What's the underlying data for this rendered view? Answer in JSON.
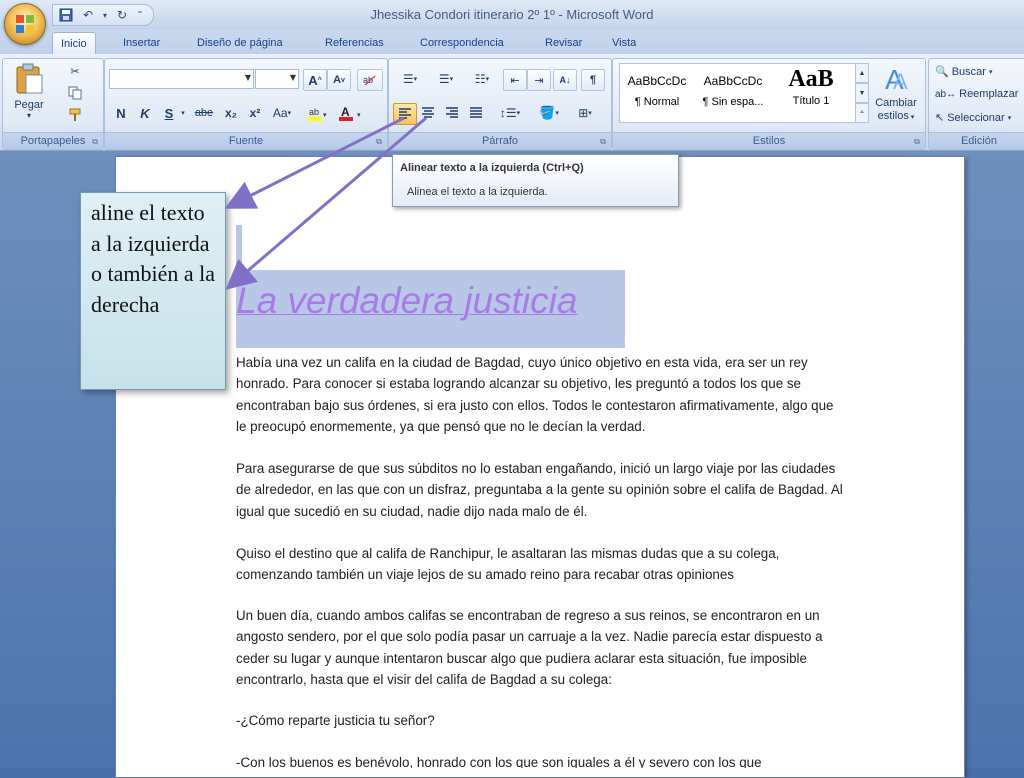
{
  "window": {
    "title": "Jhessika Condori itinerario 2º 1º  -  Microsoft Word"
  },
  "tabs": [
    "Inicio",
    "Insertar",
    "Diseño de página",
    "Referencias",
    "Correspondencia",
    "Revisar",
    "Vista"
  ],
  "ribbon": {
    "clipboard": {
      "label": "Portapapeles",
      "paste": "Pegar"
    },
    "font": {
      "label": "Fuente",
      "grow": "A",
      "shrink": "A",
      "bold": "N",
      "italic": "K",
      "underline": "S",
      "strike": "abe",
      "subscript": "x₂",
      "superscript": "x²",
      "case": "Aa"
    },
    "paragraph": {
      "label": "Párrafo"
    },
    "styles": {
      "label": "Estilos",
      "items": [
        {
          "sample": "AaBbCcDc",
          "name": "¶ Normal"
        },
        {
          "sample": "AaBbCcDc",
          "name": "¶ Sin espa..."
        },
        {
          "sample": "AaB",
          "name": "Título 1"
        }
      ],
      "change_line1": "Cambiar",
      "change_line2": "estilos"
    },
    "editing": {
      "label": "Edición",
      "find": "Buscar",
      "replace": "Reemplazar",
      "select": "Seleccionar"
    }
  },
  "tooltip": {
    "title": "Alinear texto a la izquierda (Ctrl+Q)",
    "description": "Alinea el texto a la izquierda."
  },
  "callout": {
    "text": "aline el texto a la izquierda o también a la derecha"
  },
  "document": {
    "title": "La verdadera justicia",
    "paragraphs": [
      "Había una vez un califa en la ciudad de Bagdad, cuyo único objetivo en esta vida, era ser un rey honrado. Para conocer si estaba logrando alcanzar  su objetivo, les preguntó a todos los que se encontraban bajo sus órdenes, si era justo con ellos. Todos le contestaron afirmativamente, algo que le preocupó enormemente, ya que pensó que no le decían la verdad.",
      "Para asegurarse de que sus súbditos no lo estaban engañando, inició un largo viaje  por las ciudades de alrededor, en las que con un disfraz, preguntaba a la gente su opinión sobre el califa de Bagdad. Al igual que sucedió en su ciudad, nadie dijo nada malo de él.",
      "Quiso el destino que al califa de Ranchipur,  le asaltaran las mismas dudas que a su colega, comenzando también un viaje lejos de su amado reino para recabar otras opiniones",
      "Un buen día, cuando ambos califas se encontraban de regreso a sus reinos, se encontraron en un angosto sendero, por el que solo podía pasar un carruaje  a la vez. Nadie parecía estar dispuesto a ceder su lugar y aunque intentaron buscar algo que pudiera aclarar esta situación, fue imposible encontrarlo, hasta que el visir del califa de Bagdad a su colega:",
      "-¿Cómo reparte justicia tu señor?",
      "-Con los buenos es benévolo, honrado con los que son iguales a él y severo con los que"
    ]
  },
  "colors": {
    "ribbon_text": "#15428b",
    "title_text": "#a97be8",
    "title_highlight": "#b8c7e6",
    "arrow": "#8070c8"
  }
}
